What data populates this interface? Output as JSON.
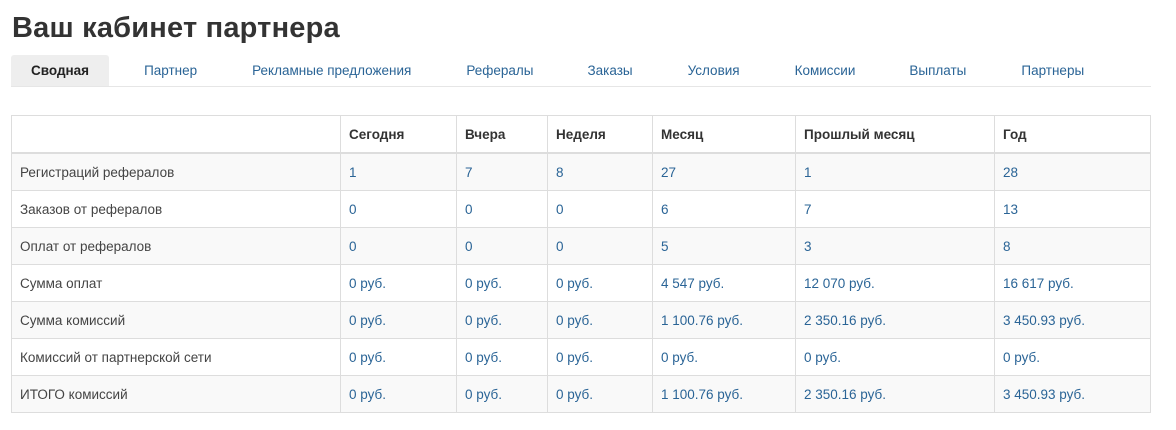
{
  "page": {
    "title": "Ваш кабинет партнера"
  },
  "tabs": [
    {
      "label": "Сводная",
      "active": true
    },
    {
      "label": "Партнер",
      "active": false
    },
    {
      "label": "Рекламные предложения",
      "active": false
    },
    {
      "label": "Рефералы",
      "active": false
    },
    {
      "label": "Заказы",
      "active": false
    },
    {
      "label": "Условия",
      "active": false
    },
    {
      "label": "Комиссии",
      "active": false
    },
    {
      "label": "Выплаты",
      "active": false
    },
    {
      "label": "Партнеры",
      "active": false
    }
  ],
  "table": {
    "headers": [
      "",
      "Сегодня",
      "Вчера",
      "Неделя",
      "Месяц",
      "Прошлый месяц",
      "Год"
    ],
    "rows": [
      {
        "label": "Регистраций рефералов",
        "values": [
          "1",
          "7",
          "8",
          "27",
          "1",
          "28"
        ]
      },
      {
        "label": "Заказов от рефералов",
        "values": [
          "0",
          "0",
          "0",
          "6",
          "7",
          "13"
        ]
      },
      {
        "label": "Оплат от рефералов",
        "values": [
          "0",
          "0",
          "0",
          "5",
          "3",
          "8"
        ]
      },
      {
        "label": "Сумма оплат",
        "values": [
          "0 руб.",
          "0 руб.",
          "0 руб.",
          "4 547 руб.",
          "12 070 руб.",
          "16 617 руб."
        ]
      },
      {
        "label": "Сумма комиссий",
        "values": [
          "0 руб.",
          "0 руб.",
          "0 руб.",
          "1 100.76 руб.",
          "2 350.16 руб.",
          "3 450.93 руб."
        ]
      },
      {
        "label": "Комиссий от партнерской сети",
        "values": [
          "0 руб.",
          "0 руб.",
          "0 руб.",
          "0 руб.",
          "0 руб.",
          "0 руб."
        ]
      },
      {
        "label": "ИТОГО комиссий",
        "values": [
          "0 руб.",
          "0 руб.",
          "0 руб.",
          "1 100.76 руб.",
          "2 350.16 руб.",
          "3 450.93 руб."
        ]
      }
    ]
  },
  "colors": {
    "link": "#2a6496",
    "active_tab_bg": "#eeeeee",
    "border": "#dddddd",
    "stripe": "#f9f9f9"
  }
}
